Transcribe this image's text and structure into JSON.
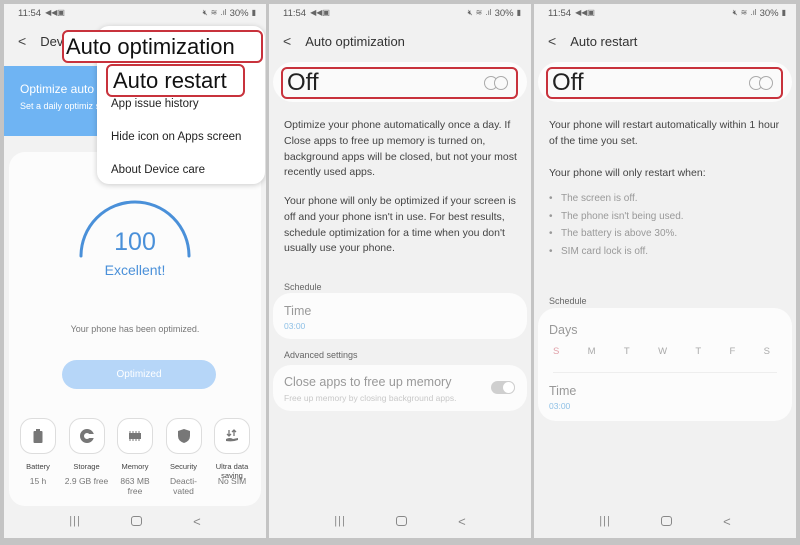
{
  "status_bar": {
    "time": "11:54",
    "battery": "30%"
  },
  "panel1": {
    "title_partial": "Dev",
    "promo": {
      "title": "Optimize auto",
      "subtitle": "Set a daily optimiz shape."
    },
    "score": "100",
    "rating": "Excellent!",
    "message": "Your phone has been optimized.",
    "button": "Optimized",
    "tiles": [
      {
        "icon": "battery-icon",
        "label": "Battery",
        "value": "15 h"
      },
      {
        "icon": "storage-icon",
        "label": "Storage",
        "value": "2.9 GB free"
      },
      {
        "icon": "memory-icon",
        "label": "Memory",
        "value": "863 MB free"
      },
      {
        "icon": "security-icon",
        "label": "Security",
        "value": "Deacti-vated"
      },
      {
        "icon": "data-saving-icon",
        "label": "Ultra data saving",
        "value": "No SIM"
      }
    ],
    "menu": {
      "highlight1": "Auto optimization",
      "highlight2": "Auto restart",
      "items": [
        "App issue history",
        "Hide icon on Apps screen",
        "About Device care"
      ]
    }
  },
  "panel2": {
    "title": "Auto optimization",
    "switch_label": "Off",
    "switch_on": false,
    "desc1": "Optimize your phone automatically once a day. If Close apps to free up memory is turned on, background apps will be closed, but not your most recently used apps.",
    "desc2": "Your phone will only be optimized if your screen is off and your phone isn't in use. For best results, schedule optimization for a time when you don't usually use your phone.",
    "schedule_header": "Schedule",
    "time_label": "Time",
    "time_value": "03:00",
    "advanced_header": "Advanced settings",
    "close_apps_title": "Close apps to free up memory",
    "close_apps_sub": "Free up memory by closing background apps.",
    "close_apps_on": true
  },
  "panel3": {
    "title": "Auto restart",
    "switch_label": "Off",
    "switch_on": false,
    "desc1": "Your phone will restart automatically within 1 hour of the time you set.",
    "desc2": "Your phone will only restart when:",
    "conditions": [
      "The screen is off.",
      "The phone isn't being used.",
      "The battery is above 30%.",
      "SIM card lock is off."
    ],
    "schedule_header": "Schedule",
    "days_label": "Days",
    "days": [
      "S",
      "M",
      "T",
      "W",
      "T",
      "F",
      "S"
    ],
    "time_label": "Time",
    "time_value": "03:00"
  },
  "colors": {
    "accent": "#4a90d9",
    "highlight_border": "#c8323c",
    "promo": "#6fb4f3",
    "sunday": "#e0a0a8"
  }
}
